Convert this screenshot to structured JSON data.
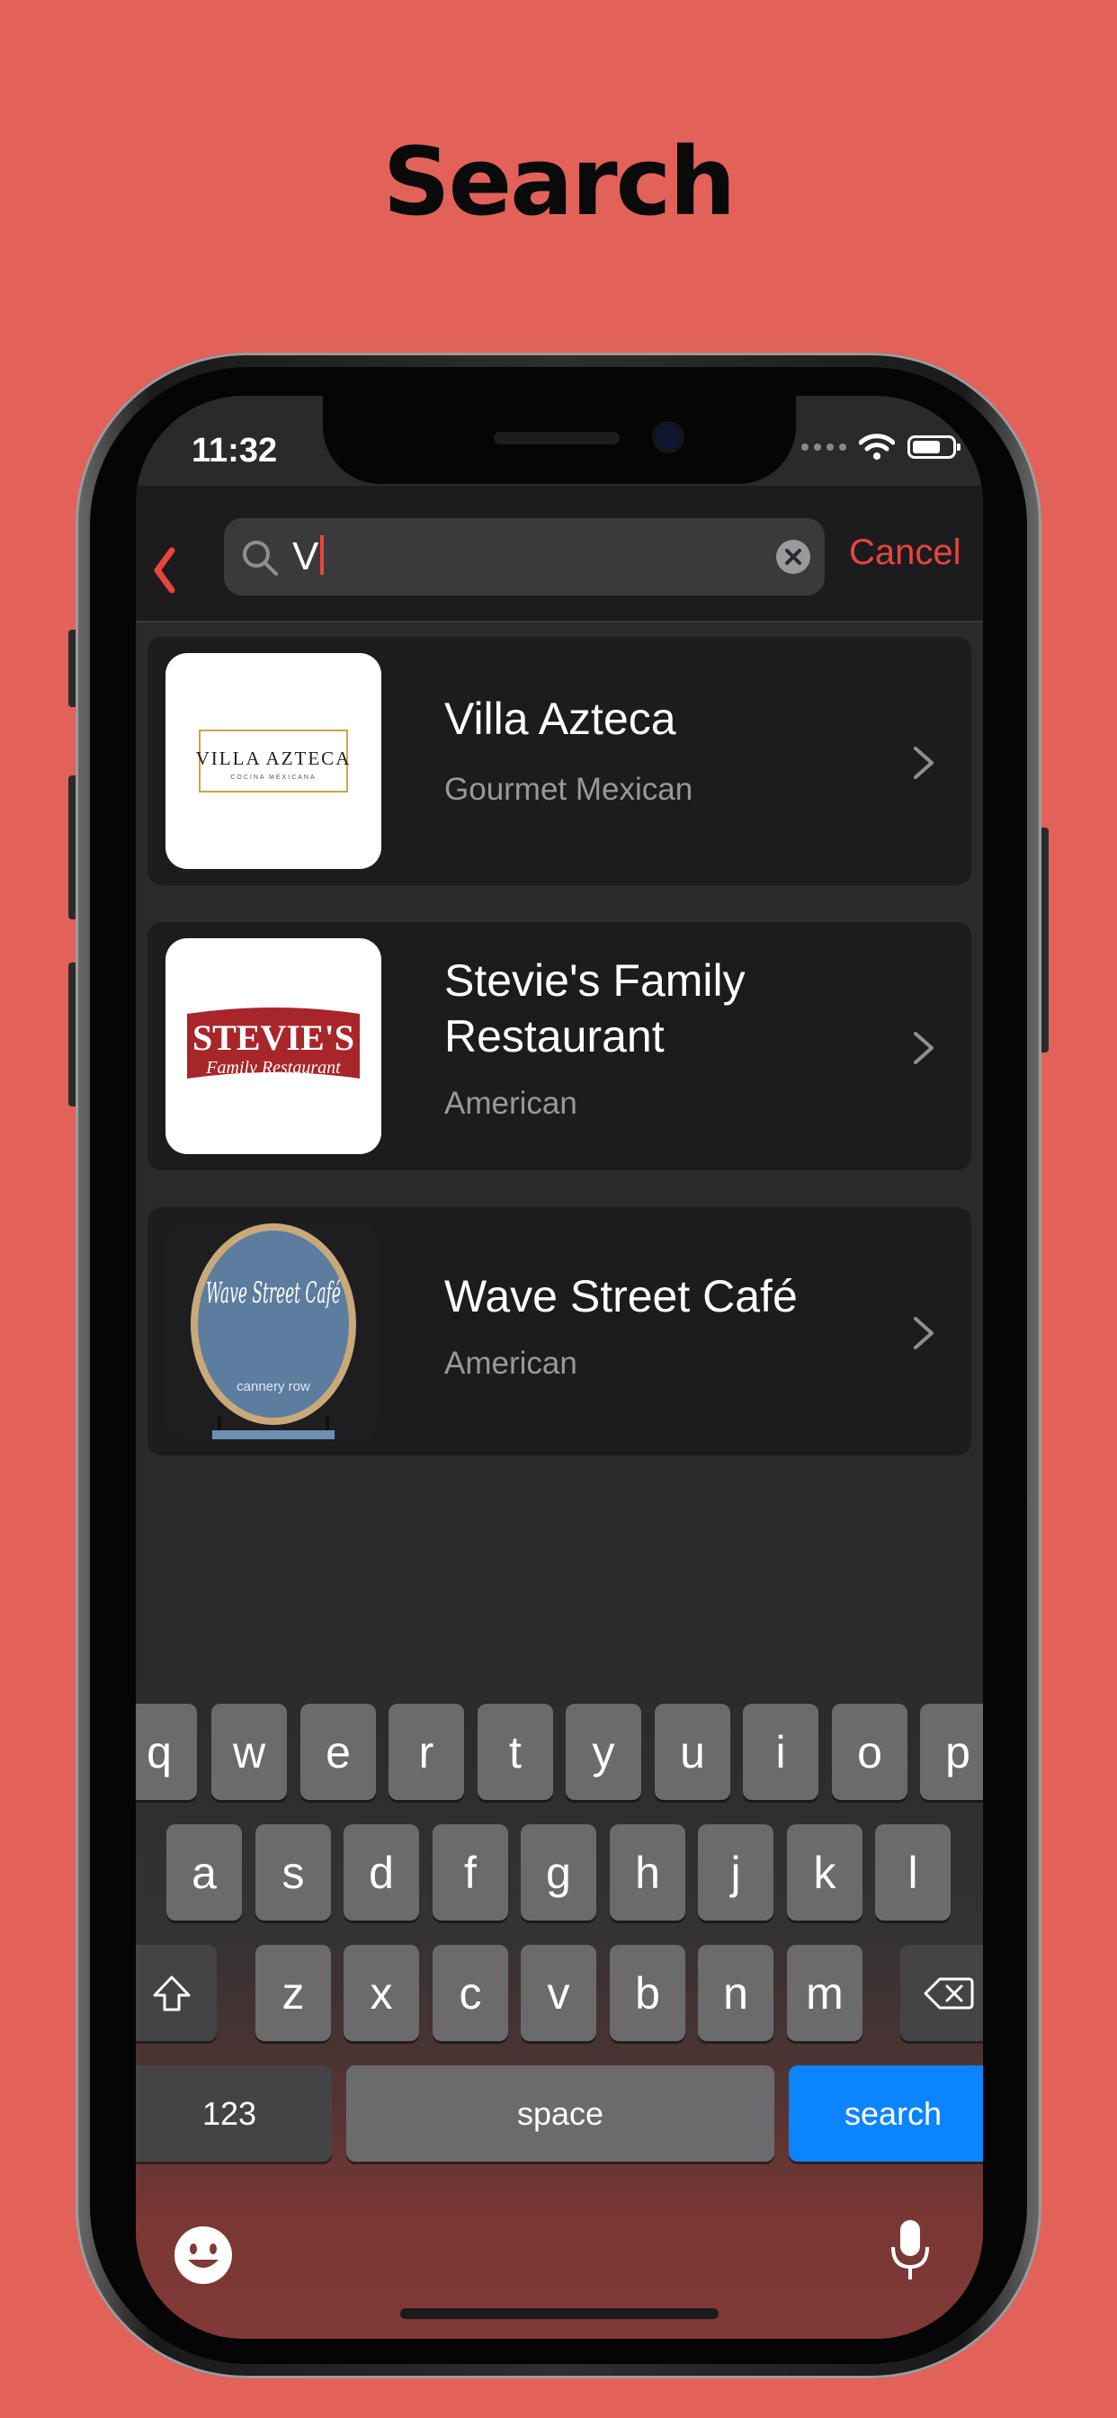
{
  "page": {
    "headline": "Search"
  },
  "status_bar": {
    "time": "11:32"
  },
  "search": {
    "query": "V",
    "cancel_label": "Cancel"
  },
  "results": [
    {
      "name": "Villa Azteca",
      "cuisine": "Gourmet Mexican",
      "logo_text": "VILLA AZTECA",
      "logo_subtext": "COCINA MEXICANA"
    },
    {
      "name": "Stevie's Family Restaurant",
      "cuisine": "American",
      "logo_text": "STEVIE'S",
      "logo_subtext": "Family Restaurant"
    },
    {
      "name": "Wave Street Café",
      "cuisine": "American",
      "logo_text": "Wave Street Café",
      "logo_subtext": "cannery row"
    }
  ],
  "keyboard": {
    "row1": [
      "q",
      "w",
      "e",
      "r",
      "t",
      "y",
      "u",
      "i",
      "o",
      "p"
    ],
    "row2": [
      "a",
      "s",
      "d",
      "f",
      "g",
      "h",
      "j",
      "k",
      "l"
    ],
    "row3": [
      "z",
      "x",
      "c",
      "v",
      "b",
      "n",
      "m"
    ],
    "numbers_label": "123",
    "space_label": "space",
    "search_label": "search"
  },
  "colors": {
    "background": "#e2625a",
    "accent": "#e8453c",
    "search_key": "#0a84ff"
  }
}
